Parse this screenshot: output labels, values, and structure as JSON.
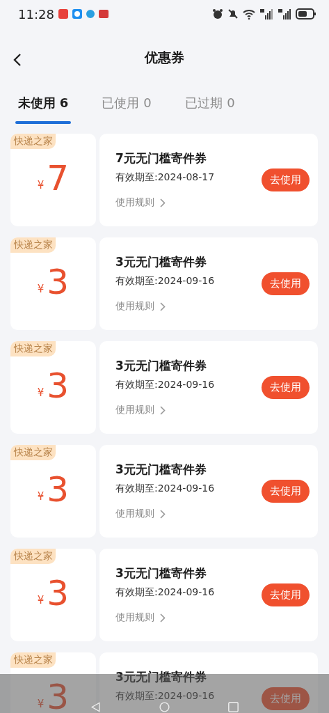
{
  "status_bar": {
    "time": "11:28"
  },
  "header": {
    "title": "优惠券"
  },
  "tabs": [
    {
      "label": "未使用",
      "count": "6",
      "selected": true
    },
    {
      "label": "已使用",
      "count": "0",
      "selected": false
    },
    {
      "label": "已过期",
      "count": "0",
      "selected": false
    }
  ],
  "coupons": [
    {
      "tag": "快递之家",
      "currency": "¥",
      "amount": "7",
      "title": "7元无门槛寄件券",
      "validity": "有效期至:2024-08-17",
      "rules": "使用规则",
      "button": "去使用"
    },
    {
      "tag": "快递之家",
      "currency": "¥",
      "amount": "3",
      "title": "3元无门槛寄件券",
      "validity": "有效期至:2024-09-16",
      "rules": "使用规则",
      "button": "去使用"
    },
    {
      "tag": "快递之家",
      "currency": "¥",
      "amount": "3",
      "title": "3元无门槛寄件券",
      "validity": "有效期至:2024-09-16",
      "rules": "使用规则",
      "button": "去使用"
    },
    {
      "tag": "快递之家",
      "currency": "¥",
      "amount": "3",
      "title": "3元无门槛寄件券",
      "validity": "有效期至:2024-09-16",
      "rules": "使用规则",
      "button": "去使用"
    },
    {
      "tag": "快递之家",
      "currency": "¥",
      "amount": "3",
      "title": "3元无门槛寄件券",
      "validity": "有效期至:2024-09-16",
      "rules": "使用规则",
      "button": "去使用"
    },
    {
      "tag": "快递之家",
      "currency": "¥",
      "amount": "3",
      "title": "3元无门槛寄件券",
      "validity": "有效期至:2024-09-16",
      "button": "去使用"
    }
  ]
}
